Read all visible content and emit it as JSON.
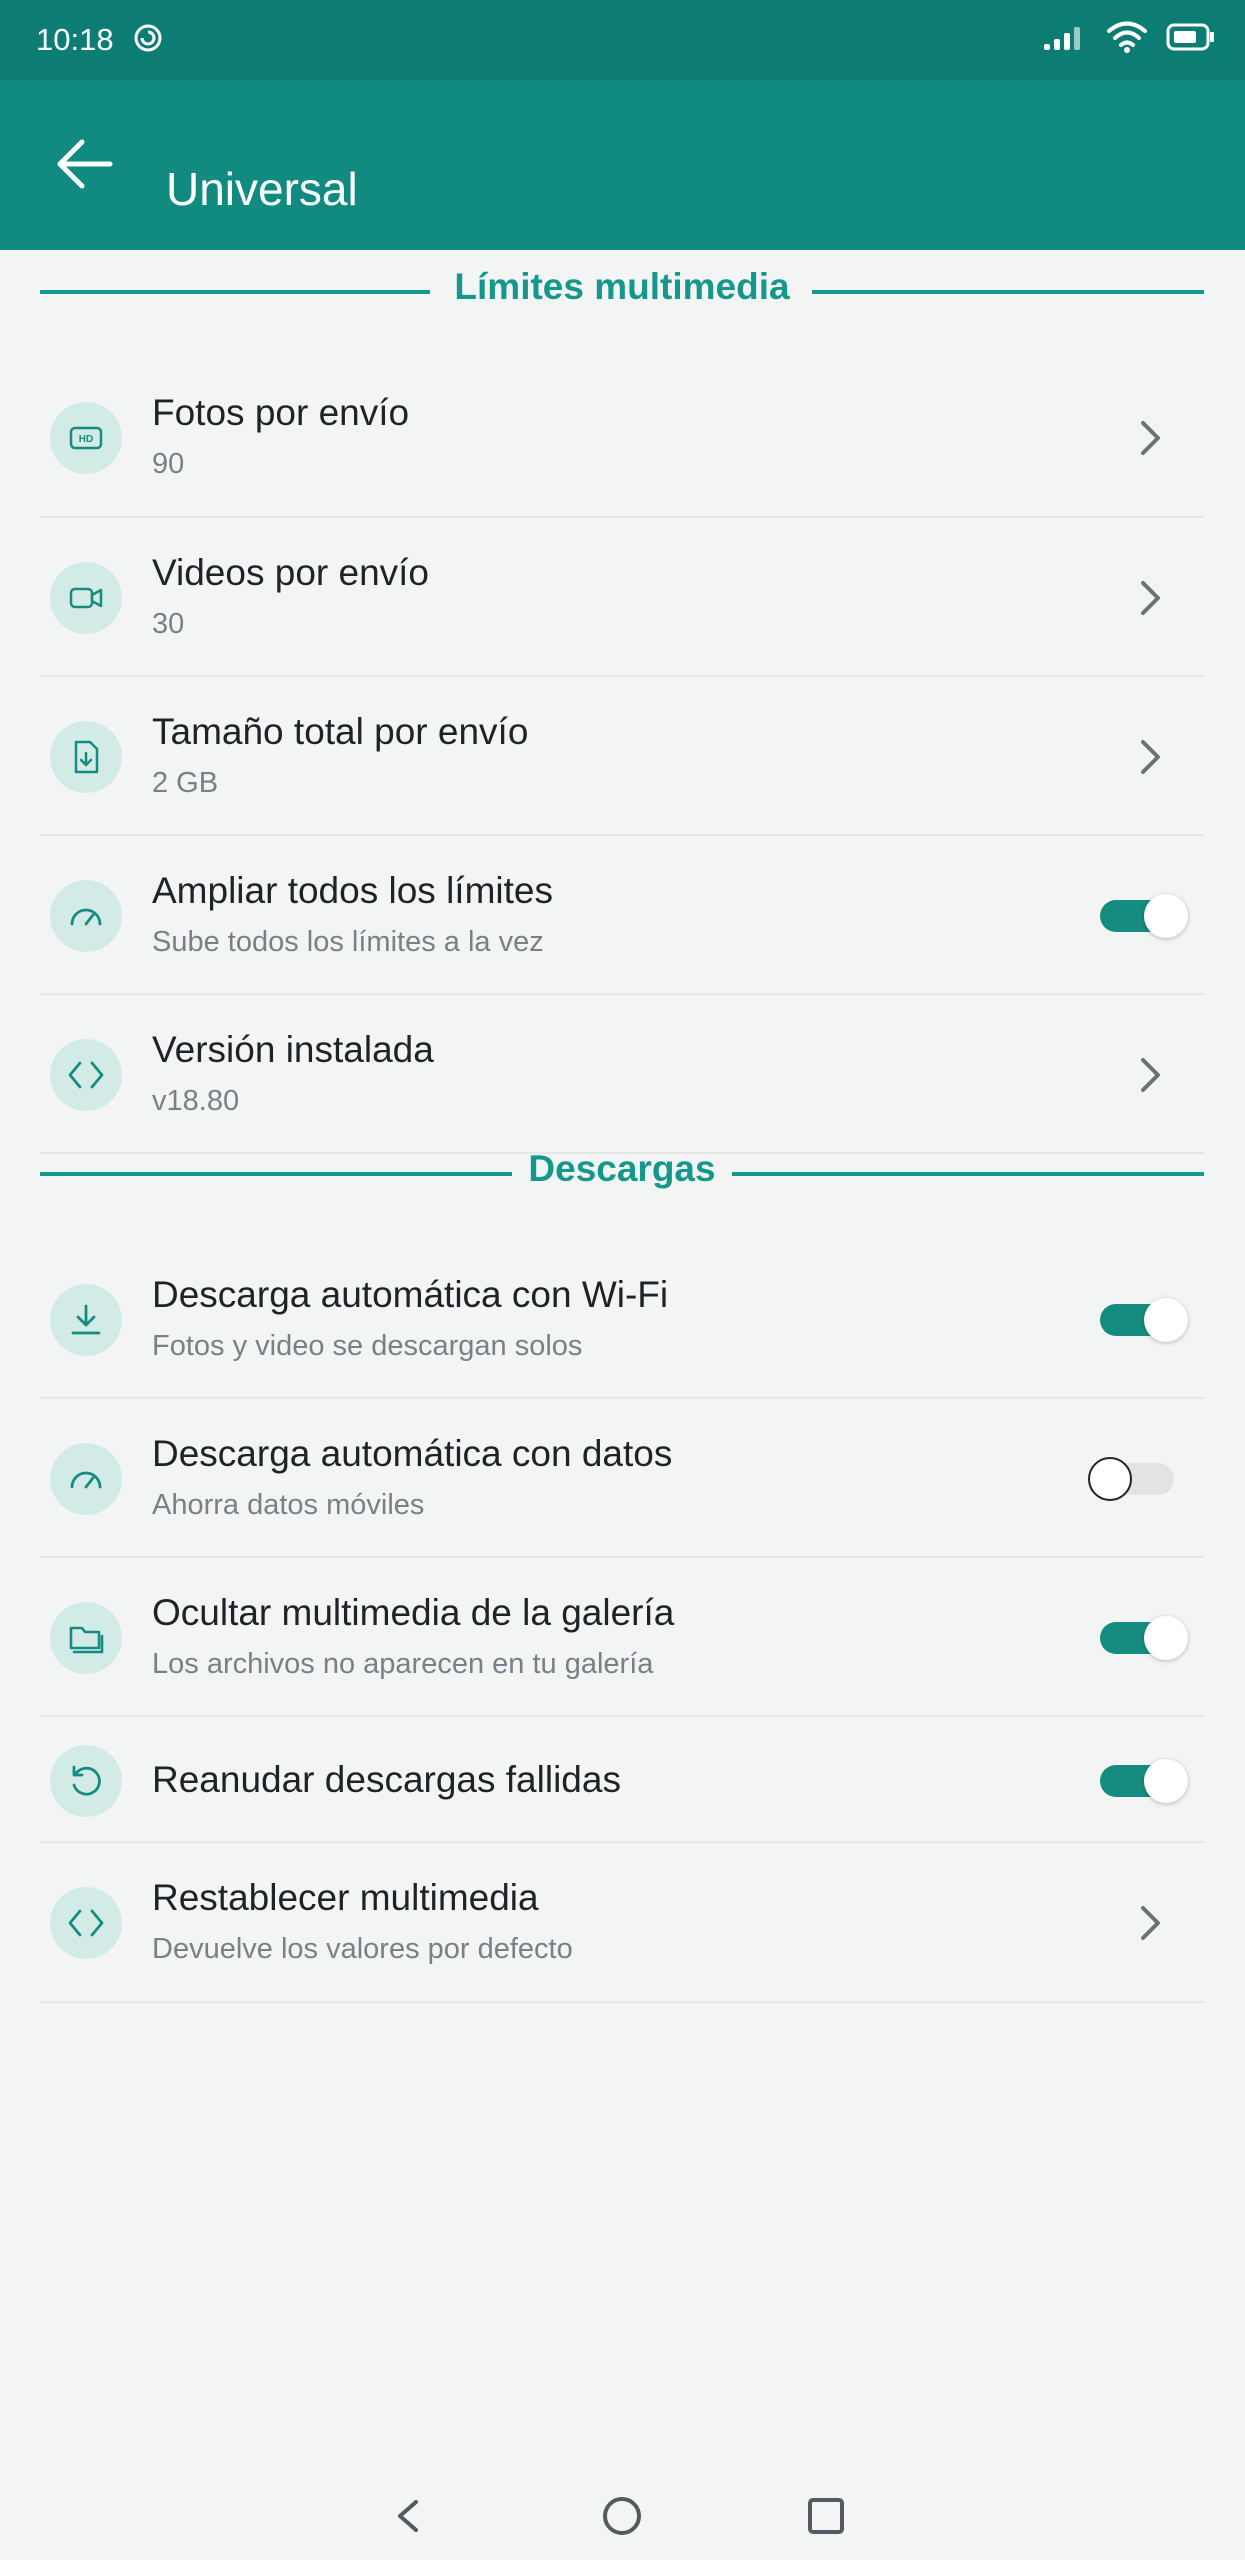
{
  "status_bar": {
    "time": "10:18",
    "icons": [
      "sync-icon",
      "signal-icon",
      "wifi-icon",
      "battery-icon"
    ]
  },
  "app_bar": {
    "title": "Universal",
    "back_icon": "arrow-left-icon",
    "color": "#118b7f"
  },
  "colors": {
    "status_bar": "#0d7c72",
    "accent": "#16978b",
    "toggle_on": "#168c80",
    "icon_background": "#d3ebe7",
    "background": "#f3f5f4"
  },
  "sections": [
    {
      "title": "Límites multimedia",
      "items": [
        {
          "title": "Fotos por envío",
          "subtitle": "90",
          "icon": "hd-icon",
          "control": "chevron"
        },
        {
          "title": "Videos por envío",
          "subtitle": "30",
          "icon": "video-camera-icon",
          "control": "chevron"
        },
        {
          "title": "Tamaño total por envío",
          "subtitle": "2 GB",
          "icon": "file-download-icon",
          "control": "chevron"
        },
        {
          "title": "Ampliar todos los límites",
          "subtitle": "Sube todos los límites a la vez",
          "icon": "speedometer-icon",
          "control": "toggle",
          "checked": true
        },
        {
          "title": "Versión instalada",
          "subtitle": "v18.80",
          "icon": "code-icon",
          "control": "chevron"
        }
      ]
    },
    {
      "title": "Descargas",
      "items": [
        {
          "title": "Descarga automática con Wi-Fi",
          "subtitle": "Fotos y video se descargan solos",
          "icon": "download-icon",
          "control": "toggle",
          "checked": true
        },
        {
          "title": "Descarga automática con datos",
          "subtitle": "Ahorra datos móviles",
          "icon": "speedometer-icon",
          "control": "toggle",
          "checked": false
        },
        {
          "title": "Ocultar multimedia de la galería",
          "subtitle": "Los archivos no aparecen en tu galería",
          "icon": "folder-icon",
          "control": "toggle",
          "checked": true
        },
        {
          "title": "Reanudar descargas fallidas",
          "subtitle": "",
          "icon": "refresh-icon",
          "control": "toggle",
          "checked": true
        },
        {
          "title": "Restablecer multimedia",
          "subtitle": "Devuelve los valores por defecto",
          "icon": "code-icon",
          "control": "chevron"
        }
      ]
    }
  ],
  "nav_bar": {
    "buttons": [
      "back-triangle-icon",
      "home-circle-icon",
      "recents-square-icon"
    ]
  }
}
